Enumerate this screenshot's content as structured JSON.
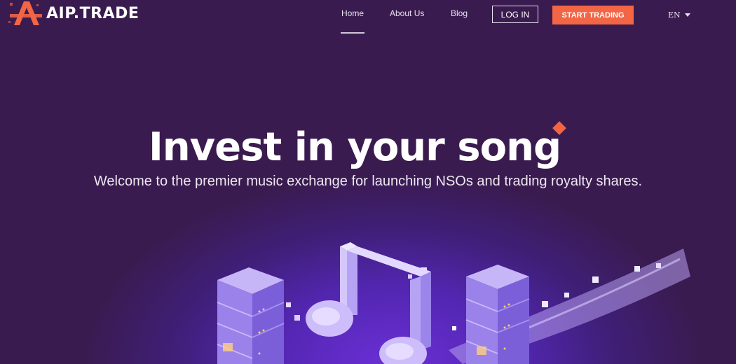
{
  "brand": {
    "name": "AIP.TRADE",
    "accent_color": "#f26545",
    "background_color": "#3a1b4f",
    "logo_icon": "aip-logo-icon"
  },
  "nav": {
    "items": [
      {
        "label": "Home",
        "active": true
      },
      {
        "label": "About Us",
        "active": false
      },
      {
        "label": "Blog",
        "active": false
      }
    ],
    "login_label": "LOG IN",
    "start_label": "START TRADING",
    "language": "EN"
  },
  "hero": {
    "title": "Invest in your song",
    "subtitle": "Welcome to the premier music exchange for launching NSOs and trading royalty shares.",
    "illustration_icon": "music-note-servers-illustration"
  }
}
